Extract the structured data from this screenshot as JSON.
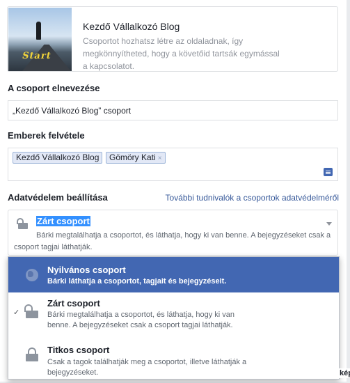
{
  "header": {
    "title": "Kezdő Vállalkozó Blog",
    "description": "Csoportot hozhatsz létre az oldaladnak, így megkönnyítheted, hogy a követőid tartsák egymással a kapcsolatot.",
    "cover_text": "Start"
  },
  "group_name": {
    "label": "A csoport elnevezése",
    "value": "„Kezdő Vállalkozó Blog” csoport"
  },
  "people": {
    "label": "Emberek felvétele",
    "tokens": [
      "Kezdő Vállalkozó Blog",
      "Gömöry Kati"
    ],
    "remove_glyph": "×"
  },
  "privacy": {
    "label": "Adatvédelem beállítása",
    "link": "További tudnivalók a csoportok adatvédelméről",
    "selected_title": "Zárt csoport",
    "selected_desc": "Bárki megtalálhatja a csoportot, és láthatja, hogy ki van benne. A bejegyzéseket csak a csoport tagjai láthatják.",
    "options": [
      {
        "title": "Nyilvános csoport",
        "desc": "Bárki láthatja a csoportot, tagjait és bejegyzéseit.",
        "icon": "globe-icon",
        "highlighted": true
      },
      {
        "title": "Zárt csoport",
        "desc": "Bárki megtalálhatja a csoportot, és láthatja, hogy ki van benne. A bejegyzéseket csak a csoport tagjai láthatják.",
        "icon": "lock-icon",
        "checked": true
      },
      {
        "title": "Titkos csoport",
        "desc": "Csak a tagok találhatják meg a csoportot, illetve láthatják a bejegyzéseket.",
        "icon": "lock-icon"
      }
    ],
    "check_glyph": "✓"
  },
  "background": {
    "side_text": "képe"
  },
  "colors": {
    "accent": "#4267b2",
    "link": "#365899",
    "selection": "#3390ff"
  }
}
